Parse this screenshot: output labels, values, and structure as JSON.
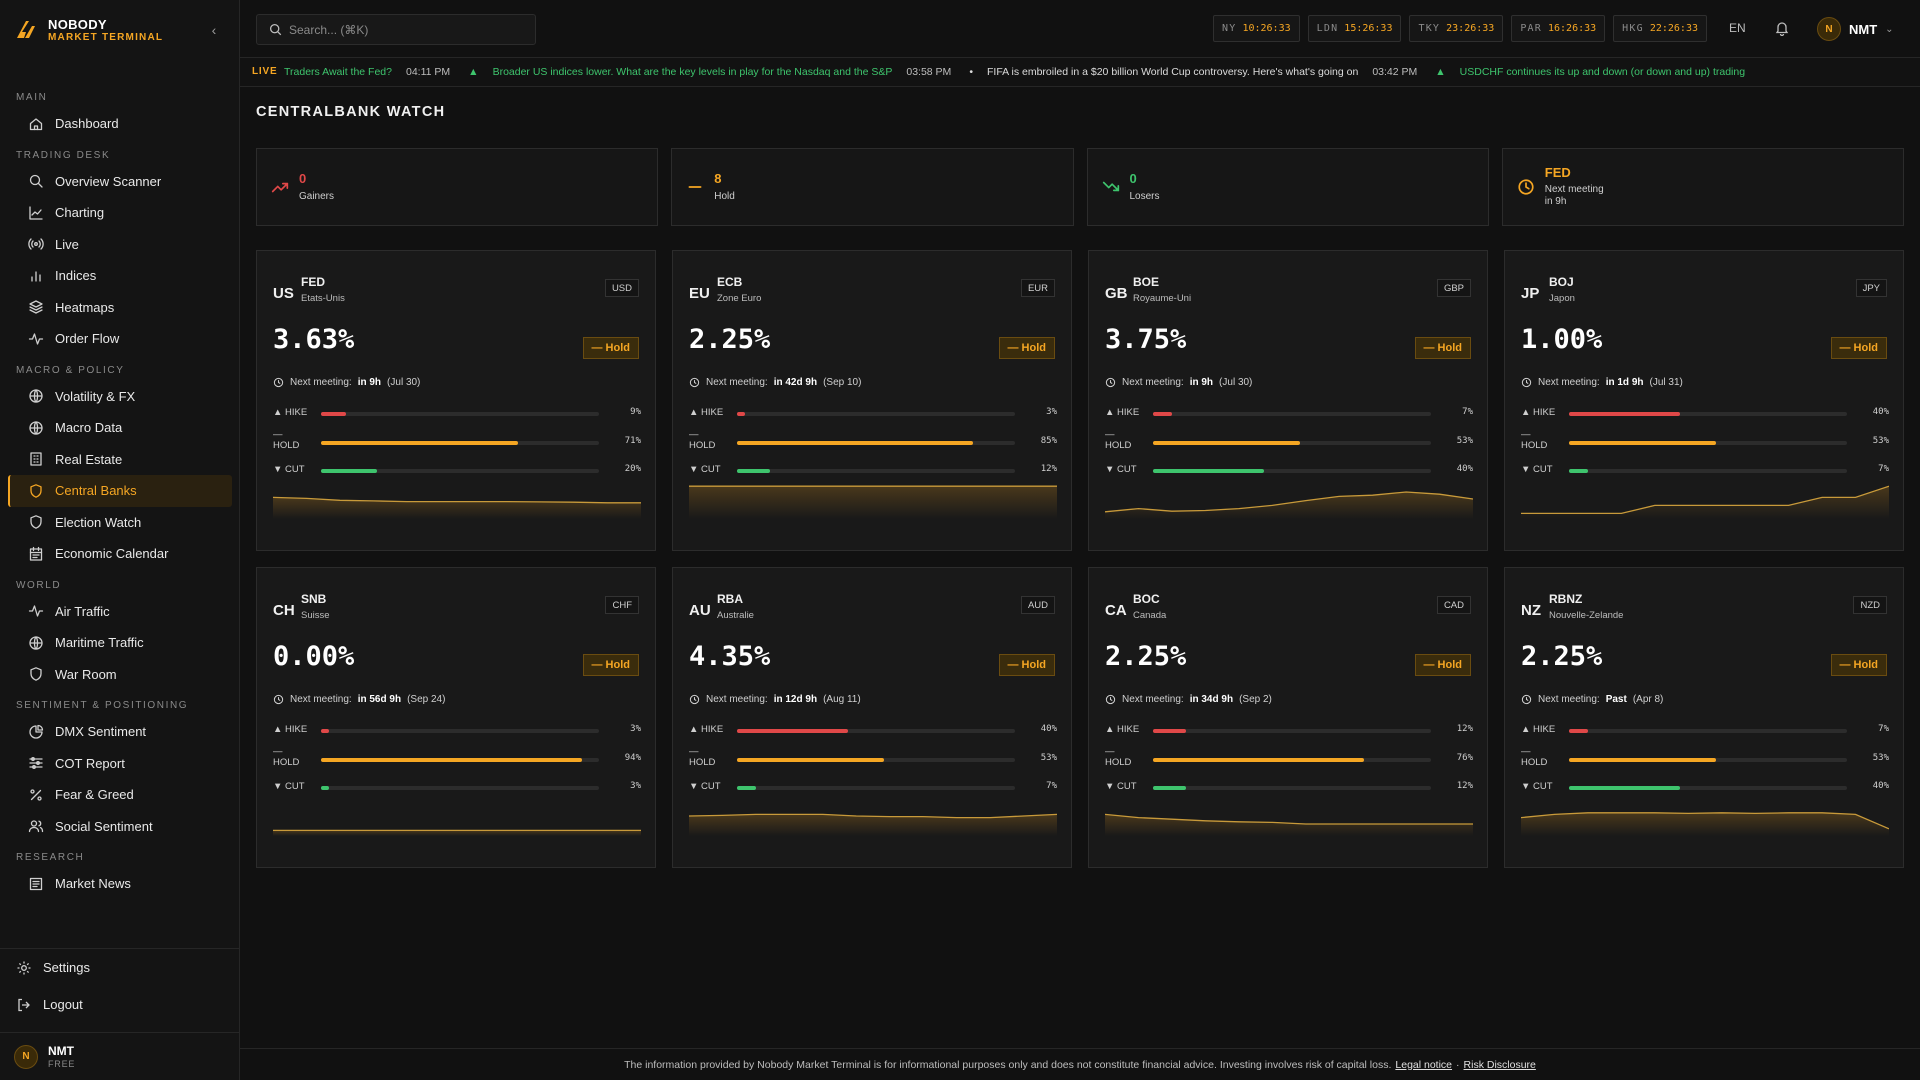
{
  "brand": {
    "name": "NOBODY",
    "sub": "MARKET TERMINAL"
  },
  "sidebar": {
    "sections": [
      {
        "title": "MAIN",
        "items": [
          {
            "label": "Dashboard",
            "icon": "home-icon"
          }
        ]
      },
      {
        "title": "TRADING DESK",
        "items": [
          {
            "label": "Overview Scanner",
            "icon": "search-icon"
          },
          {
            "label": "Charting",
            "icon": "line-chart-icon"
          },
          {
            "label": "Live",
            "icon": "broadcast-icon"
          },
          {
            "label": "Indices",
            "icon": "bar-chart-icon"
          },
          {
            "label": "Heatmaps",
            "icon": "layers-icon"
          },
          {
            "label": "Order Flow",
            "icon": "activity-icon"
          }
        ]
      },
      {
        "title": "MACRO & POLICY",
        "items": [
          {
            "label": "Volatility & FX",
            "icon": "globe-icon"
          },
          {
            "label": "Macro Data",
            "icon": "globe-icon"
          },
          {
            "label": "Real Estate",
            "icon": "building-icon"
          },
          {
            "label": "Central Banks",
            "icon": "shield-icon",
            "active": true
          },
          {
            "label": "Election Watch",
            "icon": "shield-icon"
          },
          {
            "label": "Economic Calendar",
            "icon": "calendar-icon"
          }
        ]
      },
      {
        "title": "WORLD",
        "items": [
          {
            "label": "Air Traffic",
            "icon": "activity-icon"
          },
          {
            "label": "Maritime Traffic",
            "icon": "globe-icon"
          },
          {
            "label": "War Room",
            "icon": "shield-icon"
          }
        ]
      },
      {
        "title": "SENTIMENT & POSITIONING",
        "items": [
          {
            "label": "DMX Sentiment",
            "icon": "pie-chart-icon"
          },
          {
            "label": "COT Report",
            "icon": "sliders-icon"
          },
          {
            "label": "Fear & Greed",
            "icon": "percent-icon"
          },
          {
            "label": "Social Sentiment",
            "icon": "users-icon"
          }
        ]
      },
      {
        "title": "RESEARCH",
        "items": [
          {
            "label": "Market News",
            "icon": "newspaper-icon"
          }
        ]
      }
    ],
    "settings_label": "Settings",
    "logout_label": "Logout",
    "user": {
      "initial": "N",
      "name": "NMT",
      "plan": "FREE"
    }
  },
  "topbar": {
    "search_placeholder": "Search... (⌘K)",
    "clocks": [
      {
        "city": "NY",
        "time": "10:26:33"
      },
      {
        "city": "LDN",
        "time": "15:26:33"
      },
      {
        "city": "TKY",
        "time": "23:26:33"
      },
      {
        "city": "PAR",
        "time": "16:26:33"
      },
      {
        "city": "HKG",
        "time": "22:26:33"
      }
    ],
    "lang": "EN",
    "user_initial": "N",
    "user_name": "NMT"
  },
  "ticker": {
    "live_label": "LIVE",
    "items": [
      {
        "prefix": "",
        "headline": "Traders Await the Fed?",
        "time": "04:11 PM",
        "tone": "green"
      },
      {
        "prefix": "▲",
        "headline": "Broader US indices lower. What are the key levels in play for the Nasdaq and the S&P",
        "time": "03:58 PM",
        "tone": "green"
      },
      {
        "prefix": "•",
        "headline": "FIFA is embroiled in a $20 billion World Cup controversy. Here's what's going on",
        "time": "03:42 PM",
        "tone": "white"
      },
      {
        "prefix": "▲",
        "headline": "USDCHF continues its up and down (or down and up) trading",
        "time": "",
        "tone": "green"
      }
    ]
  },
  "page": {
    "title": "CENTRALBANK WATCH"
  },
  "summary": [
    {
      "value": "0",
      "label": "Gainers",
      "color": "#e04848",
      "icon": "trending-up-icon"
    },
    {
      "value": "8",
      "label": "Hold",
      "color": "#f5a623",
      "icon": "minus-icon"
    },
    {
      "value": "0",
      "label": "Losers",
      "color": "#3ec46d",
      "icon": "trending-down-icon"
    },
    {
      "value": "FED",
      "label": "Next meeting",
      "sub2": "in 9h",
      "color": "#f5a623",
      "icon": "clock-icon"
    }
  ],
  "labels": {
    "next_meeting": "Next meeting:",
    "hike": "HIKE",
    "hold": "HOLD",
    "cut": "CUT",
    "hold_dash": "—"
  },
  "banks": [
    {
      "cc": "US",
      "name": "FED",
      "country": "Etats-Unis",
      "ccy": "USD",
      "rate": "3.63%",
      "status": "— Hold",
      "next_in": "in 9h",
      "next_date": "(Jul 30)",
      "hike": 9,
      "hold": 71,
      "cut": 20,
      "spark": [
        0.55,
        0.52,
        0.46,
        0.44,
        0.42,
        0.42,
        0.42,
        0.42,
        0.41,
        0.4,
        0.38,
        0.38
      ]
    },
    {
      "cc": "EU",
      "name": "ECB",
      "country": "Zone Euro",
      "ccy": "EUR",
      "rate": "2.25%",
      "status": "— Hold",
      "next_in": "in 42d 9h",
      "next_date": "(Sep 10)",
      "hike": 3,
      "hold": 85,
      "cut": 12,
      "spark": [
        0.9,
        0.9,
        0.9,
        0.9,
        0.9,
        0.9,
        0.9,
        0.9,
        0.9,
        0.9,
        0.9,
        0.9
      ]
    },
    {
      "cc": "GB",
      "name": "BOE",
      "country": "Royaume-Uni",
      "ccy": "GBP",
      "rate": "3.75%",
      "status": "— Hold",
      "next_in": "in 9h",
      "next_date": "(Jul 30)",
      "hike": 7,
      "hold": 53,
      "cut": 40,
      "spark": [
        0.1,
        0.2,
        0.12,
        0.14,
        0.2,
        0.3,
        0.45,
        0.58,
        0.62,
        0.72,
        0.65,
        0.5
      ]
    },
    {
      "cc": "JP",
      "name": "BOJ",
      "country": "Japon",
      "ccy": "JPY",
      "rate": "1.00%",
      "status": "— Hold",
      "next_in": "in 1d 9h",
      "next_date": "(Jul 31)",
      "hike": 40,
      "hold": 53,
      "cut": 7,
      "spark": [
        0.05,
        0.05,
        0.05,
        0.05,
        0.3,
        0.3,
        0.3,
        0.3,
        0.3,
        0.55,
        0.55,
        0.9
      ]
    },
    {
      "cc": "CH",
      "name": "SNB",
      "country": "Suisse",
      "ccy": "CHF",
      "rate": "0.00%",
      "status": "— Hold",
      "next_in": "in 56d 9h",
      "next_date": "(Sep 24)",
      "hike": 3,
      "hold": 94,
      "cut": 3,
      "spark": [
        0.05,
        0.05,
        0.05,
        0.05,
        0.05,
        0.05,
        0.05,
        0.05,
        0.05,
        0.05,
        0.05,
        0.05
      ]
    },
    {
      "cc": "AU",
      "name": "RBA",
      "country": "Australie",
      "ccy": "AUD",
      "rate": "4.35%",
      "status": "— Hold",
      "next_in": "in 12d 9h",
      "next_date": "(Aug 11)",
      "hike": 40,
      "hold": 53,
      "cut": 7,
      "spark": [
        0.5,
        0.52,
        0.55,
        0.55,
        0.55,
        0.5,
        0.48,
        0.48,
        0.45,
        0.45,
        0.5,
        0.55
      ]
    },
    {
      "cc": "CA",
      "name": "BOC",
      "country": "Canada",
      "ccy": "CAD",
      "rate": "2.25%",
      "status": "— Hold",
      "next_in": "in 34d 9h",
      "next_date": "(Sep 2)",
      "hike": 12,
      "hold": 76,
      "cut": 12,
      "spark": [
        0.55,
        0.45,
        0.4,
        0.35,
        0.32,
        0.3,
        0.25,
        0.25,
        0.25,
        0.25,
        0.25,
        0.25
      ]
    },
    {
      "cc": "NZ",
      "name": "RBNZ",
      "country": "Nouvelle-Zelande",
      "ccy": "NZD",
      "rate": "2.25%",
      "status": "— Hold",
      "next_in": "Past",
      "next_date": "(Apr 8)",
      "hike": 7,
      "hold": 53,
      "cut": 40,
      "spark": [
        0.45,
        0.55,
        0.6,
        0.6,
        0.6,
        0.58,
        0.6,
        0.58,
        0.6,
        0.6,
        0.55,
        0.1
      ]
    }
  ],
  "colors": {
    "hike": "#e04848",
    "hold": "#f5a623",
    "cut": "#3ec46d",
    "accent": "#f5a623"
  },
  "footer": {
    "text": "The information provided by Nobody Market Terminal is for informational purposes only and does not constitute financial advice. Investing involves risk of capital loss.",
    "legal": "Legal notice",
    "sep": "·",
    "risk": "Risk Disclosure"
  }
}
